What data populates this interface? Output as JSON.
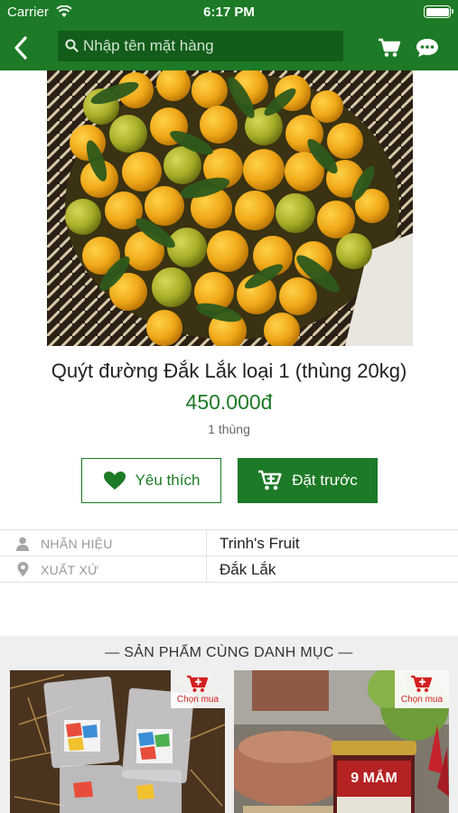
{
  "status_bar": {
    "carrier": "Carrier",
    "time": "6:17 PM"
  },
  "header": {
    "search_placeholder": "Nhập tên mặt hàng"
  },
  "product": {
    "title": "Quýt đường Đắk Lắk loại 1 (thùng 20kg)",
    "price": "450.000đ",
    "unit": "1 thùng"
  },
  "actions": {
    "favorite_label": "Yêu thích",
    "preorder_label": "Đặt trước"
  },
  "info": [
    {
      "icon": "user-icon",
      "label": "NHÃN HIỆU",
      "value": "Trinh's Fruit"
    },
    {
      "icon": "location-pin-icon",
      "label": "XUẤT XỨ",
      "value": "Đắk Lắk"
    }
  ],
  "related": {
    "heading": "— SẢN PHẨM CÙNG DANH MỤC —",
    "items": [
      {
        "buy_label": "Chọn mua"
      },
      {
        "buy_label": "Chọn mua",
        "jar_label": "9 MẮM"
      }
    ]
  },
  "colors": {
    "brand_green": "#1d7a26",
    "search_bg": "#135c1a",
    "buy_red": "#d32020"
  }
}
